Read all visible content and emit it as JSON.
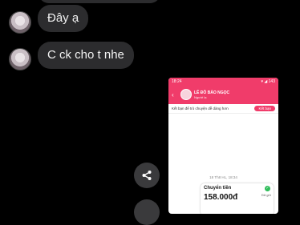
{
  "messages": [
    {
      "text": "Đây ạ"
    },
    {
      "text": "C ck cho t nhe"
    }
  ],
  "screenshot": {
    "status_left": "18:24",
    "status_right": "▾ ◢ 143",
    "contact_name": "LÊ ĐỖ BẢO NGỌC",
    "contact_sub": "Người lạ",
    "friend_prompt": "Kết bạn để trò chuyện dễ dàng hơn",
    "friend_button": "Kết bạn",
    "timestamp": "18 Th8 HL, 18:34",
    "transfer_title": "Chuyển tiền",
    "transfer_amount": "158.000đ",
    "transfer_status": "Đã gửi"
  },
  "icons": {
    "share": "share-icon",
    "back": "back-arrow-icon",
    "check": "check-icon"
  },
  "colors": {
    "bubble": "#2c2c2e",
    "accent": "#f03c6a",
    "background": "#000000"
  }
}
